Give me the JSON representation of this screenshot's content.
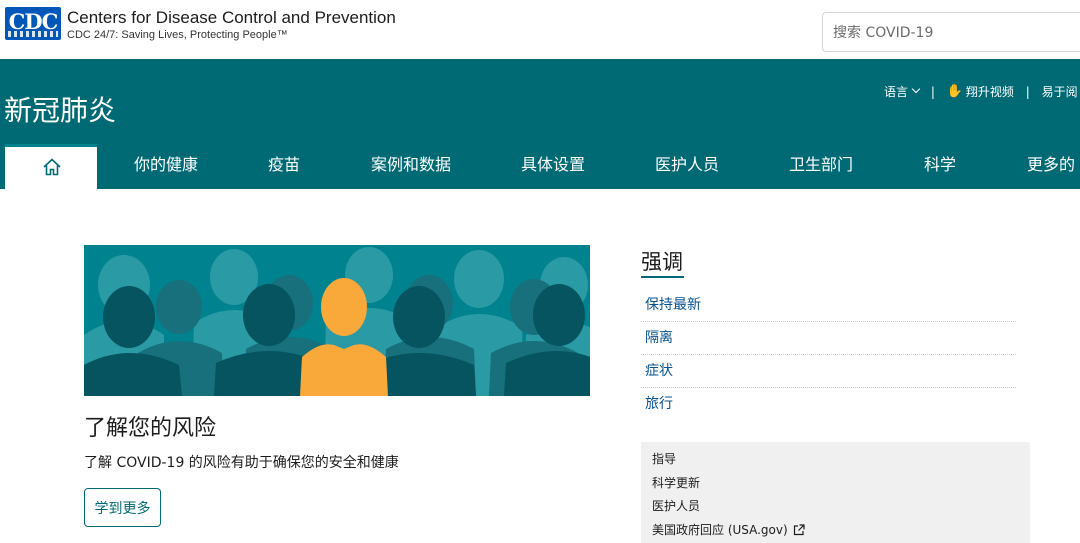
{
  "header": {
    "logo_text": "CDC",
    "org_name": "Centers for Disease Control and Prevention",
    "tagline": "CDC 24/7: Saving Lives, Protecting People™",
    "search_placeholder": "搜索 COVID-19"
  },
  "site": {
    "title": "新冠肺炎",
    "utility": {
      "language": "语言",
      "asl": "翔升视频",
      "easy_read": "易于阅"
    }
  },
  "nav": {
    "items": [
      {
        "label": "你的健康"
      },
      {
        "label": "疫苗"
      },
      {
        "label": "案例和数据"
      },
      {
        "label": "具体设置"
      },
      {
        "label": "医护人员"
      },
      {
        "label": "卫生部门"
      },
      {
        "label": "科学"
      },
      {
        "label": "更多的"
      }
    ]
  },
  "feature": {
    "title": "了解您的风险",
    "description": "了解 COVID-19 的风险有助于确保您的安全和健康",
    "button": "学到更多"
  },
  "highlights": {
    "title": "强调",
    "items": [
      "保持最新",
      "隔离",
      "症状",
      "旅行"
    ]
  },
  "guides": {
    "items": [
      "指导",
      "科学更新",
      "医护人员",
      "美国政府回应 (USA.gov)"
    ]
  },
  "colors": {
    "teal": "#006a74",
    "hero_bg": "#00838f",
    "highlight_figure": "#f9a83a",
    "link": "#075290"
  }
}
